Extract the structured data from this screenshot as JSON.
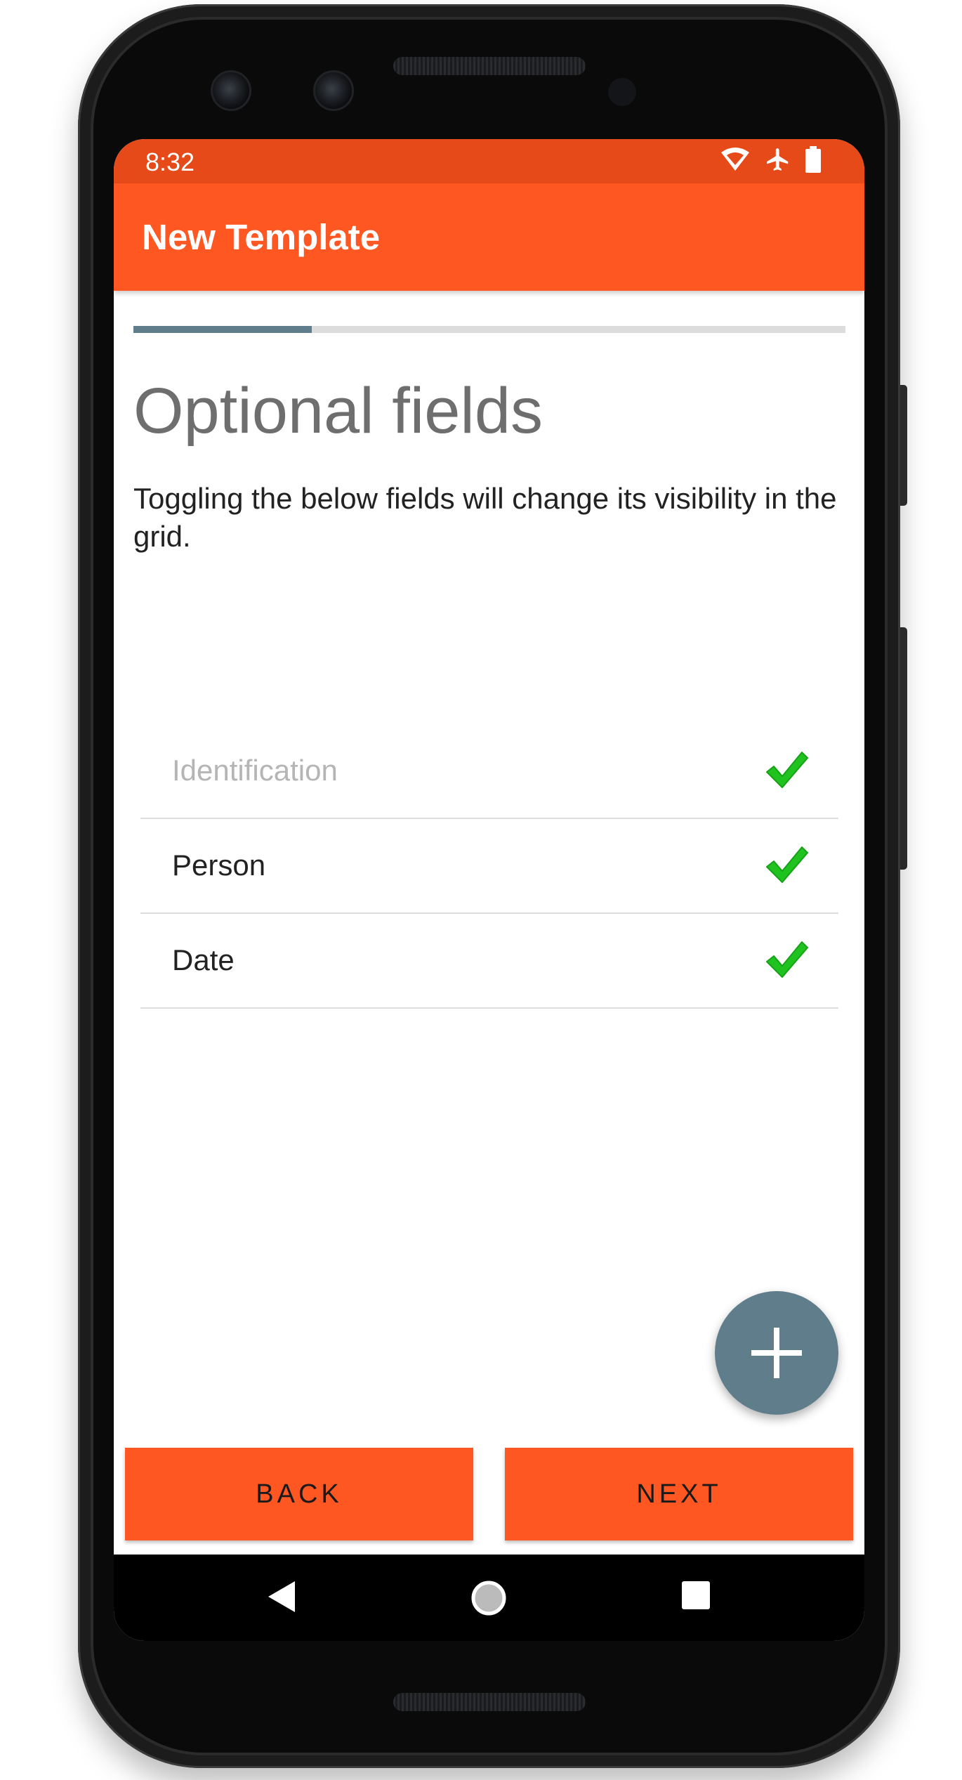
{
  "status_bar": {
    "time": "8:32",
    "icons": [
      "wifi-icon",
      "airplane-mode-icon",
      "battery-icon"
    ]
  },
  "app_bar": {
    "title": "New Template"
  },
  "wizard": {
    "progress": 0.25,
    "title": "Optional fields",
    "description": "Toggling the below fields will change its visibility in the grid."
  },
  "fields": [
    {
      "label": "Identification",
      "checked": true,
      "enabled": false
    },
    {
      "label": "Person",
      "checked": true,
      "enabled": true
    },
    {
      "label": "Date",
      "checked": true,
      "enabled": true
    }
  ],
  "fab": {
    "icon": "plus-icon"
  },
  "buttons": {
    "back_label": "BACK",
    "next_label": "NEXT"
  },
  "nav_bar": {
    "icons": [
      "nav-back-icon",
      "nav-home-icon",
      "nav-recents-icon"
    ]
  },
  "colors": {
    "status_bar": "#e64a19",
    "primary": "#ff5722",
    "accent": "#607d8b",
    "check": "#1fc21f"
  }
}
